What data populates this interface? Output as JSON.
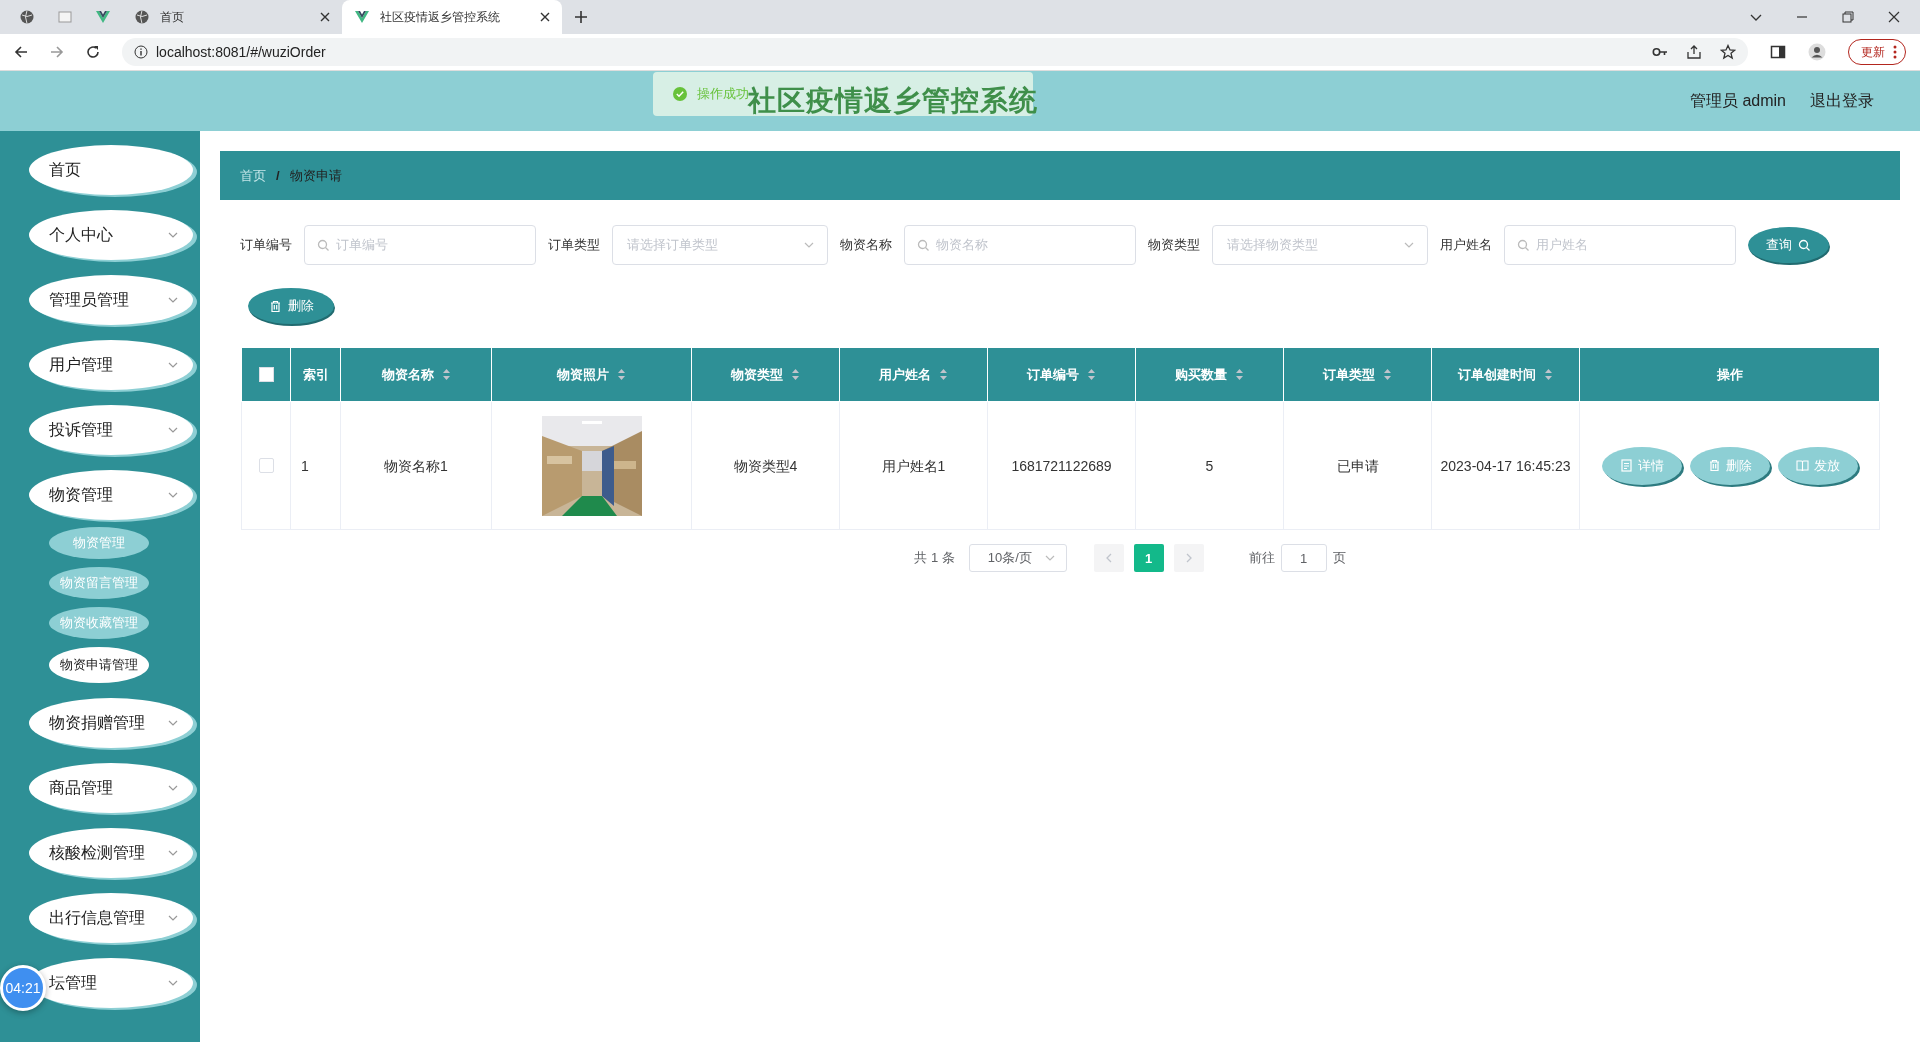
{
  "browser": {
    "tabs": [
      {
        "label": "首页",
        "selected": false
      },
      {
        "label": "社区疫情返乡管控系统",
        "selected": true
      }
    ],
    "address": "localhost:8081/#/wuziOrder",
    "update_button": "更新"
  },
  "header": {
    "title": "社区疫情返乡管控系统",
    "toast": "操作成功",
    "user": "管理员 admin",
    "logout": "退出登录"
  },
  "sidebar": {
    "items": [
      {
        "label": "首页",
        "has_submenu": false
      },
      {
        "label": "个人中心",
        "has_submenu": true
      },
      {
        "label": "管理员管理",
        "has_submenu": true
      },
      {
        "label": "用户管理",
        "has_submenu": true
      },
      {
        "label": "投诉管理",
        "has_submenu": true
      },
      {
        "label": "物资管理",
        "has_submenu": true,
        "children": [
          {
            "label": "物资管理",
            "selected": false
          },
          {
            "label": "物资留言管理",
            "selected": false
          },
          {
            "label": "物资收藏管理",
            "selected": false
          },
          {
            "label": "物资申请管理",
            "selected": true
          }
        ]
      },
      {
        "label": "物资捐赠管理",
        "has_submenu": true
      },
      {
        "label": "商品管理",
        "has_submenu": true
      },
      {
        "label": "核酸检测管理",
        "has_submenu": true
      },
      {
        "label": "出行信息管理",
        "has_submenu": true
      },
      {
        "label": "坛管理",
        "has_submenu": true
      }
    ]
  },
  "timer": "04:21",
  "breadcrumb": [
    {
      "label": "首页"
    },
    {
      "label": "物资申请"
    }
  ],
  "breadcrumb_separator": "/",
  "filters": [
    {
      "label": "订单编号",
      "kind": "input",
      "placeholder": "订单编号"
    },
    {
      "label": "订单类型",
      "kind": "select",
      "placeholder": "请选择订单类型"
    },
    {
      "label": "物资名称",
      "kind": "input",
      "placeholder": "物资名称"
    },
    {
      "label": "物资类型",
      "kind": "select",
      "placeholder": "请选择物资类型"
    },
    {
      "label": "用户姓名",
      "kind": "input",
      "placeholder": "用户姓名"
    }
  ],
  "search_button": "查询",
  "delete_button": "删除",
  "table": {
    "all_checked": false,
    "columns": [
      {
        "label": "索引",
        "sortable": false
      },
      {
        "label": "物资名称",
        "sortable": true
      },
      {
        "label": "物资照片",
        "sortable": true
      },
      {
        "label": "物资类型",
        "sortable": true
      },
      {
        "label": "用户姓名",
        "sortable": true
      },
      {
        "label": "订单编号",
        "sortable": true
      },
      {
        "label": "购买数量",
        "sortable": true
      },
      {
        "label": "订单类型",
        "sortable": true
      },
      {
        "label": "订单创建时间",
        "sortable": true
      },
      {
        "label": "操作",
        "sortable": false
      }
    ],
    "rows": [
      {
        "checked": false,
        "cells": [
          {
            "kind": "text",
            "text": "1"
          },
          {
            "kind": "text",
            "text": "物资名称1"
          },
          {
            "kind": "picture"
          },
          {
            "kind": "text",
            "text": "物资类型4"
          },
          {
            "kind": "text",
            "text": "用户姓名1"
          },
          {
            "kind": "text",
            "text": "1681721122689"
          },
          {
            "kind": "text",
            "text": "5"
          },
          {
            "kind": "text",
            "text": "已申请"
          },
          {
            "kind": "text",
            "text": "2023-04-17 16:45:23"
          },
          {
            "kind": "actions",
            "actions": [
              {
                "kind": "detail",
                "label": "详情"
              },
              {
                "kind": "delete",
                "label": "删除"
              },
              {
                "kind": "issue",
                "label": "发放"
              }
            ]
          }
        ]
      }
    ]
  },
  "pagination": {
    "total": "共 1 条",
    "page_size": "10条/页",
    "pages": [
      {
        "label": "1",
        "selected": true
      }
    ],
    "goto_label": "前往",
    "goto_value": "1",
    "goto_suffix": "页"
  }
}
